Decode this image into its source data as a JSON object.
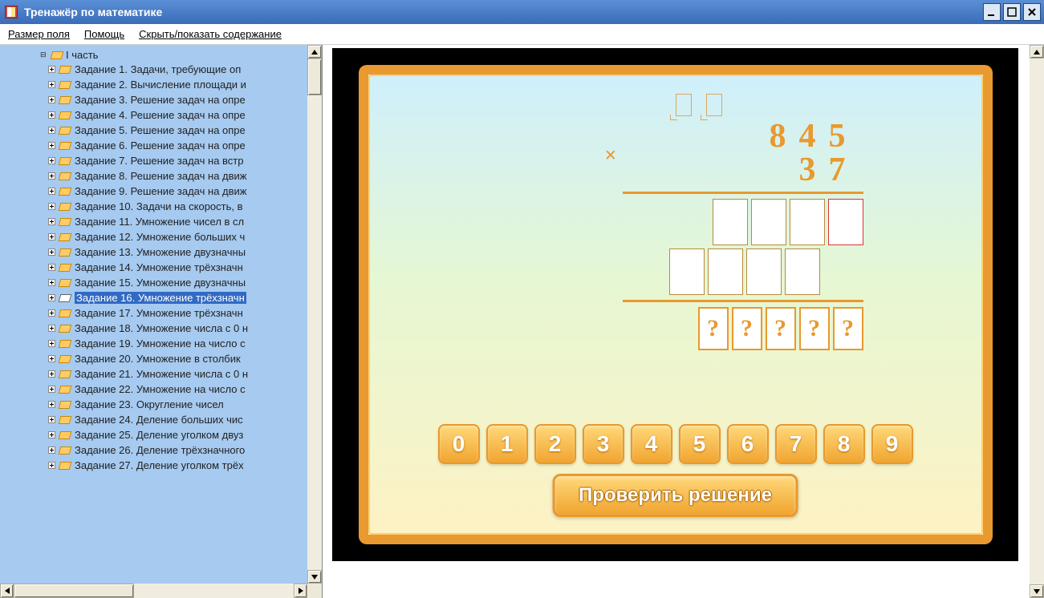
{
  "window": {
    "title": "Тренажёр по математике"
  },
  "menubar": {
    "field_size": "Размер поля",
    "help": "Помощь",
    "toggle_toc": "Скрыть/показать содержание"
  },
  "tree": {
    "root": "I часть",
    "root_expanded": true,
    "selected_index": 15,
    "items": [
      "Задание 1. Задачи, требующие оп",
      "Задание 2. Вычисление площади и",
      "Задание 3. Решение задач на опре",
      "Задание 4. Решение задач на опре",
      "Задание 5. Решение задач на опре",
      "Задание 6. Решение задач на опре",
      "Задание 7. Решение задач на встр",
      "Задание 8. Решение задач на движ",
      "Задание 9. Решение задач на движ",
      "Задание 10. Задачи на скорость, в",
      "Задание 11. Умножение чисел в сл",
      "Задание 12. Умножение больших ч",
      "Задание 13. Умножение двузначны",
      "Задание 14. Умножение трёхзначн",
      "Задание 15. Умножение двузначны",
      "Задание 16. Умножение трёхзначн",
      "Задание 17. Умножение трёхзначн",
      "Задание 18. Умножение числа с 0 н",
      "Задание 19. Умножение на число с",
      "Задание 20. Умножение в столбик",
      "Задание 21. Умножение числа с 0 н",
      "Задание 22. Умножение на число с",
      "Задание 23. Округление чисел",
      "Задание 24. Деление больших чис",
      "Задание 25. Деление уголком двуз",
      "Задание 26. Деление трёхзначного",
      "Задание 27. Деление уголком трёх"
    ]
  },
  "exercise": {
    "multiplicand": "845",
    "multiplier": "37",
    "mult_sign": "×",
    "carry_count": 2,
    "partial1_digits": 4,
    "partial2_digits": 4,
    "result_digits": 5,
    "placeholder": "?",
    "check_label": "Проверить решение",
    "digits": [
      "0",
      "1",
      "2",
      "3",
      "4",
      "5",
      "6",
      "7",
      "8",
      "9"
    ]
  }
}
